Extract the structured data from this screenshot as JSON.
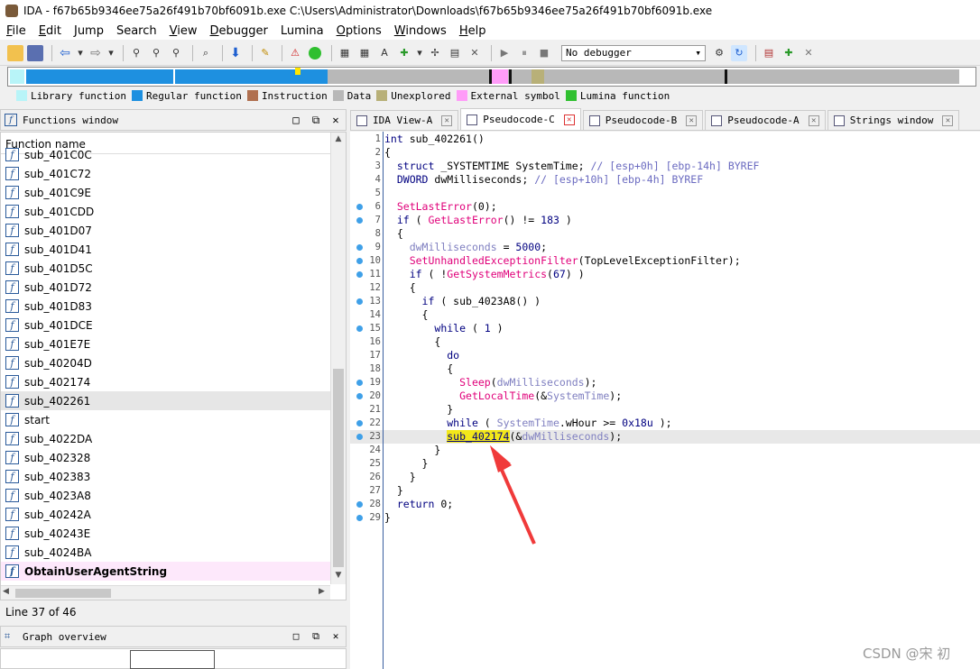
{
  "window": {
    "title": "IDA - f67b65b9346ee75a26f491b70bf6091b.exe C:\\Users\\Administrator\\Downloads\\f67b65b9346ee75a26f491b70bf6091b.exe"
  },
  "menu": [
    {
      "label": "File",
      "key": "F",
      "rest": "ile"
    },
    {
      "label": "Edit",
      "key": "E",
      "rest": "dit"
    },
    {
      "label": "Jump",
      "key": "J",
      "rest": "ump"
    },
    {
      "label": "Search",
      "key": "",
      "rest": "Search"
    },
    {
      "label": "View",
      "key": "V",
      "rest": "iew"
    },
    {
      "label": "Debugger",
      "key": "D",
      "rest": "ebugger"
    },
    {
      "label": "Lumina",
      "key": "",
      "rest": "Lumina"
    },
    {
      "label": "Options",
      "key": "O",
      "rest": "ptions"
    },
    {
      "label": "Windows",
      "key": "W",
      "rest": "indows"
    },
    {
      "label": "Help",
      "key": "H",
      "rest": "elp"
    }
  ],
  "toolbar": {
    "debugger_select": "No debugger"
  },
  "legend": [
    {
      "label": "Library function",
      "color": "#b8f4f8"
    },
    {
      "label": "Regular function",
      "color": "#1e90e0"
    },
    {
      "label": "Instruction",
      "color": "#b07050"
    },
    {
      "label": "Data",
      "color": "#b8b8b8"
    },
    {
      "label": "Unexplored",
      "color": "#b8b078"
    },
    {
      "label": "External symbol",
      "color": "#ff9cf8"
    },
    {
      "label": "Lumina function",
      "color": "#30c030"
    }
  ],
  "functions_window": {
    "title": "Functions window",
    "column": "Function name",
    "items": [
      "sub_401C0C",
      "sub_401C72",
      "sub_401C9E",
      "sub_401CDD",
      "sub_401D07",
      "sub_401D41",
      "sub_401D5C",
      "sub_401D72",
      "sub_401D83",
      "sub_401DCE",
      "sub_401E7E",
      "sub_40204D",
      "sub_402174",
      "sub_402261",
      "start",
      "sub_4022DA",
      "sub_402328",
      "sub_402383",
      "sub_4023A8",
      "sub_40242A",
      "sub_40243E",
      "sub_4024BA",
      "ObtainUserAgentString"
    ],
    "selected": "sub_402261",
    "status": "Line 37 of 46"
  },
  "graph_overview": {
    "title": "Graph overview"
  },
  "tabs": [
    {
      "label": "IDA View-A",
      "active": false
    },
    {
      "label": "Pseudocode-C",
      "active": true
    },
    {
      "label": "Pseudocode-B",
      "active": false
    },
    {
      "label": "Pseudocode-A",
      "active": false
    },
    {
      "label": "Strings window",
      "active": false
    }
  ],
  "code_lines": [
    {
      "n": "1",
      "dot": false,
      "html": "<span class='k'>int</span> sub_402261()"
    },
    {
      "n": "2",
      "dot": false,
      "html": "{"
    },
    {
      "n": "3",
      "dot": false,
      "html": "  <span class='k'>struct</span> _SYSTEMTIME SystemTime; <span class='cm'>// [esp+0h] [ebp-14h] BYREF</span>"
    },
    {
      "n": "4",
      "dot": false,
      "html": "  <span class='k'>DWORD</span> dwMilliseconds; <span class='cm'>// [esp+10h] [ebp-4h] BYREF</span>"
    },
    {
      "n": "5",
      "dot": false,
      "html": ""
    },
    {
      "n": "6",
      "dot": true,
      "html": "  <span class='fn'>SetLastError</span>(0);"
    },
    {
      "n": "7",
      "dot": true,
      "html": "  <span class='k'>if</span> ( <span class='fn'>GetLastError</span>() != <span class='num'>183</span> )"
    },
    {
      "n": "8",
      "dot": false,
      "html": "  {"
    },
    {
      "n": "9",
      "dot": true,
      "html": "    <span class='gr'>dwMilliseconds</span> = <span class='num'>5000</span>;"
    },
    {
      "n": "10",
      "dot": true,
      "html": "    <span class='fn'>SetUnhandledExceptionFilter</span>(TopLevelExceptionFilter);"
    },
    {
      "n": "11",
      "dot": true,
      "html": "    <span class='k'>if</span> ( !<span class='fn'>GetSystemMetrics</span>(<span class='num'>67</span>) )"
    },
    {
      "n": "12",
      "dot": false,
      "html": "    {"
    },
    {
      "n": "13",
      "dot": true,
      "html": "      <span class='k'>if</span> ( sub_4023A8() )"
    },
    {
      "n": "14",
      "dot": false,
      "html": "      {"
    },
    {
      "n": "15",
      "dot": true,
      "html": "        <span class='k'>while</span> ( <span class='num'>1</span> )"
    },
    {
      "n": "16",
      "dot": false,
      "html": "        {"
    },
    {
      "n": "17",
      "dot": false,
      "html": "          <span class='k'>do</span>"
    },
    {
      "n": "18",
      "dot": false,
      "html": "          {"
    },
    {
      "n": "19",
      "dot": true,
      "html": "            <span class='fn'>Sleep</span>(<span class='gr'>dwMilliseconds</span>);"
    },
    {
      "n": "20",
      "dot": true,
      "html": "            <span class='fn'>GetLocalTime</span>(&amp;<span class='gr'>SystemTime</span>);"
    },
    {
      "n": "21",
      "dot": false,
      "html": "          }"
    },
    {
      "n": "22",
      "dot": true,
      "html": "          <span class='k'>while</span> ( <span class='gr'>SystemTime</span>.wHour &gt;= <span class='num'>0x18u</span> );"
    },
    {
      "n": "23",
      "dot": true,
      "html": "          <span class='hl'>sub_402174</span>(&amp;<span class='gr'>dwMilliseconds</span>);",
      "current": true
    },
    {
      "n": "24",
      "dot": false,
      "html": "        }"
    },
    {
      "n": "25",
      "dot": false,
      "html": "      }"
    },
    {
      "n": "26",
      "dot": false,
      "html": "    }"
    },
    {
      "n": "27",
      "dot": false,
      "html": "  }"
    },
    {
      "n": "28",
      "dot": true,
      "html": "  <span class='k'>return</span> 0;"
    },
    {
      "n": "29",
      "dot": true,
      "html": "}"
    }
  ],
  "watermark": "CSDN @宋 初"
}
